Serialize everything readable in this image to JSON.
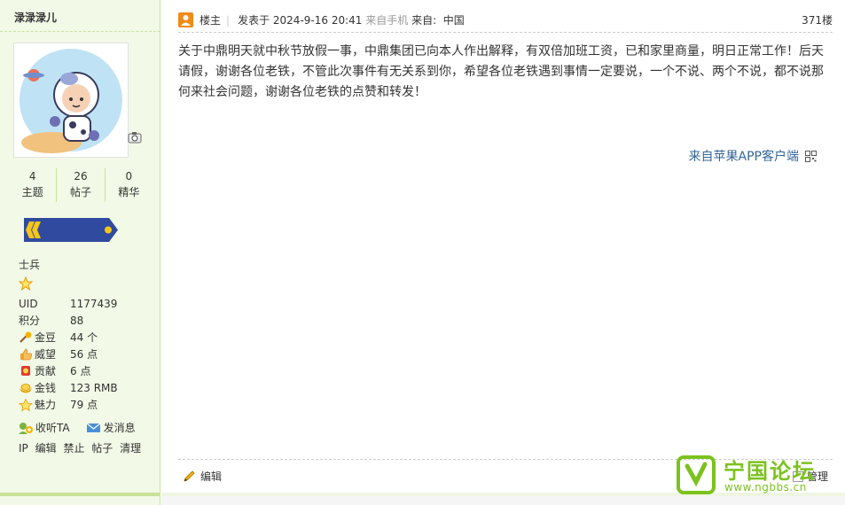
{
  "user": {
    "name": "渌渌渌儿",
    "stats": [
      {
        "value": "4",
        "label": "主题"
      },
      {
        "value": "26",
        "label": "帖子"
      },
      {
        "value": "0",
        "label": "精华"
      }
    ],
    "rank_title": "士兵",
    "info": [
      {
        "key": "UID",
        "value": "1177439",
        "icon": ""
      },
      {
        "key": "积分",
        "value": "88",
        "icon": ""
      },
      {
        "key": "金豆",
        "value": "44 个",
        "icon": "golden-bean-icon"
      },
      {
        "key": "威望",
        "value": "56 点",
        "icon": "thumbs-up-icon"
      },
      {
        "key": "贡献",
        "value": "6 点",
        "icon": "medal-icon"
      },
      {
        "key": "金钱",
        "value": "123 RMB",
        "icon": "gold-ingot-icon"
      },
      {
        "key": "魅力",
        "value": "79 点",
        "icon": "star-icon"
      }
    ],
    "actions": {
      "follow": "收听TA",
      "message": "发消息"
    },
    "admin_links": [
      "IP",
      "编辑",
      "禁止",
      "帖子",
      "清理"
    ]
  },
  "post": {
    "op_label": "楼主",
    "posted_prefix": "发表于",
    "posted_time": "2024-9-16 20:41",
    "device": "来自手机",
    "location_prefix": "来自:",
    "location": "中国",
    "floor": "371楼",
    "body": "关于中鼎明天就中秋节放假一事，中鼎集团已向本人作出解释，有双倍加班工资，已和家里商量，明日正常工作！后天请假，谢谢各位老铁，不管此次事件有无关系到你，希望各位老铁遇到事情一定要说，一个不说、两个不说，都不说那何来社会问题，谢谢各位老铁的点赞和转发！",
    "client": "来自苹果APP客户端",
    "edit_label": "编辑",
    "manage_label": "管理"
  },
  "watermark": {
    "title": "宁国论坛",
    "url": "www.ngbbs.cn"
  },
  "colors": {
    "sidebar_bg": "#f2f9e6",
    "accent_green": "#7cc21f",
    "rank_badge": "#2f4a9e",
    "op_icon": "#f08a18"
  }
}
